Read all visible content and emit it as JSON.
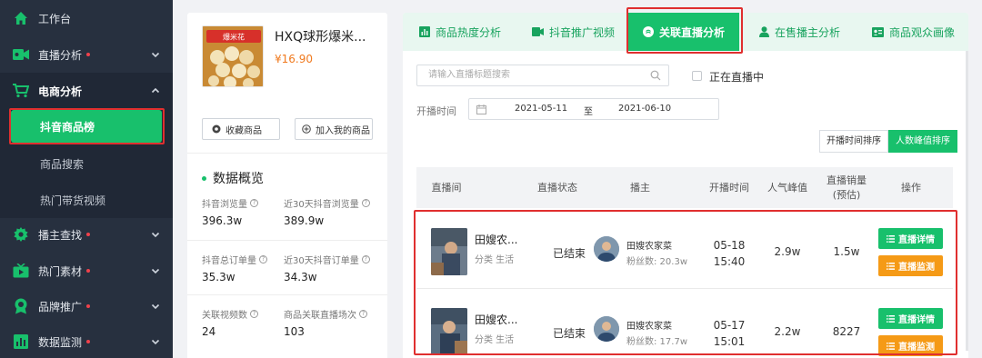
{
  "sidebar": {
    "items": [
      {
        "label": "工作台",
        "icon": "home-icon",
        "dot": false
      },
      {
        "label": "直播分析",
        "icon": "video-icon",
        "dot": true
      },
      {
        "label": "电商分析",
        "icon": "cart-icon",
        "dot": false
      },
      {
        "label": "播主查找",
        "icon": "gear-icon",
        "dot": true
      },
      {
        "label": "热门素材",
        "icon": "tv-icon",
        "dot": true
      },
      {
        "label": "品牌推广",
        "icon": "badge-icon",
        "dot": true
      },
      {
        "label": "数据监测",
        "icon": "chart-icon",
        "dot": true
      }
    ],
    "subitems": [
      "抖音商品榜",
      "商品搜索",
      "热门带货视频"
    ],
    "active_subitem": "抖音商品榜"
  },
  "product": {
    "name": "HXQ球形爆米...",
    "price": "¥16.90",
    "thumb_text": "爆米花",
    "collect_label": "收藏商品",
    "add_label": "加入我的商品",
    "overview_title": "数据概览",
    "stats": [
      {
        "label": "抖音浏览量",
        "value": "396.3w"
      },
      {
        "label": "近30天抖音浏览量",
        "value": "389.9w"
      },
      {
        "label": "抖音总订单量",
        "value": "35.3w"
      },
      {
        "label": "近30天抖音订单量",
        "value": "34.3w"
      },
      {
        "label": "关联视频数",
        "value": "24"
      },
      {
        "label": "商品关联直播场次",
        "value": "103"
      }
    ]
  },
  "tabs": [
    {
      "label": "商品热度分析",
      "icon": "stats-icon"
    },
    {
      "label": "抖音推广视频",
      "icon": "play-icon"
    },
    {
      "label": "关联直播分析",
      "icon": "live-icon"
    },
    {
      "label": "在售播主分析",
      "icon": "user-icon"
    },
    {
      "label": "商品观众画像",
      "icon": "id-card-icon"
    }
  ],
  "filters": {
    "search_placeholder": "请输入直播标题搜索",
    "live_now_label": "正在直播中",
    "time_label": "开播时间",
    "date_from": "2021-05-11",
    "date_to_sep": "至",
    "date_to": "2021-06-10"
  },
  "sort": {
    "options": [
      "开播时间排序",
      "人数峰值排序"
    ],
    "active": "人数峰值排序"
  },
  "table": {
    "headers": [
      "直播间",
      "直播状态",
      "播主",
      "开播时间",
      "人气峰值",
      "直播销量\n(预估)",
      "操作"
    ],
    "rows": [
      {
        "title": "田嫂农...",
        "category": "分类 生活",
        "status": "已结束",
        "host": "田嫂农家菜",
        "fans": "粉丝数: 20.3w",
        "date": "05-18",
        "time": "15:40",
        "peak": "2.9w",
        "sales": "1.5w",
        "detail_label": "直播详情",
        "monitor_label": "直播监测"
      },
      {
        "title": "田嫂农...",
        "category": "分类 生活",
        "status": "已结束",
        "host": "田嫂农家菜",
        "fans": "粉丝数: 17.7w",
        "date": "05-17",
        "time": "15:01",
        "peak": "2.2w",
        "sales": "8227",
        "detail_label": "直播详情",
        "monitor_label": "直播监测"
      }
    ]
  },
  "colors": {
    "accent": "#18c06c",
    "orange": "#f59a16",
    "sidebar_bg": "#27303f",
    "highlight_red": "#e02f2f"
  }
}
